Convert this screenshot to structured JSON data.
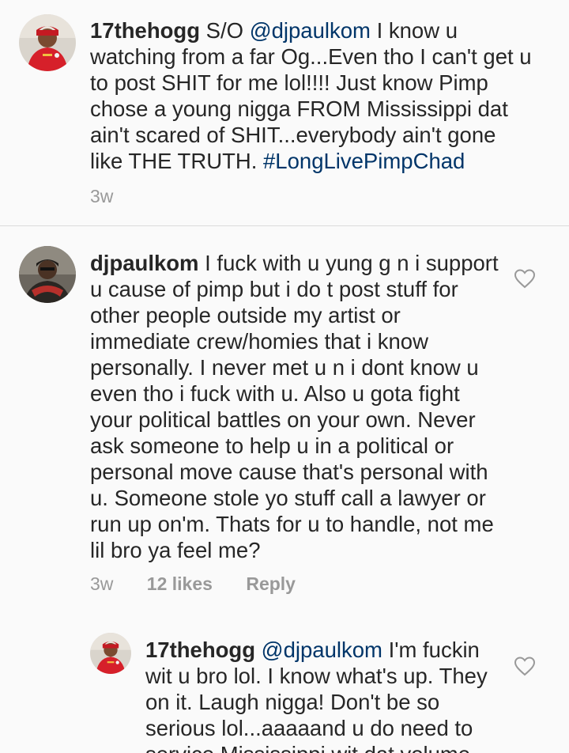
{
  "comments": [
    {
      "username": "17thehogg",
      "prefix": " S/O ",
      "mention": "@djpaulkom",
      "text": " I know u watching from a far Og...Even tho I can't get u to post SHIT for me lol!!!! Just know Pimp chose a young nigga FROM Mississippi dat ain't scared of SHIT...everybody ain't gone like THE TRUTH. ",
      "hashtag": "#LongLivePimpChad",
      "time": "3w"
    },
    {
      "username": "djpaulkom",
      "text": " I fuck with u yung g n i support u cause of pimp but i do t post stuff for other people outside my artist or immediate crew/homies that i know personally. I never met u n i dont know u even tho i fuck with u. Also u gota fight your political battles on your own. Never ask someone to help u in a political or personal move cause that's personal with u. Someone stole yo stuff call a lawyer or run up on'm. Thats for u to handle, not me lil bro ya feel me?",
      "time": "3w",
      "likes": "12 likes",
      "reply": "Reply",
      "icon": "heart-outline-icon"
    },
    {
      "username": "17thehogg",
      "mention": "@djpaulkom",
      "text": " I'm fuckin wit u bro lol. I know what's up. They on it. Laugh nigga! Don't be so serious lol...aaaaand u do need to service Mississippi wit dat volume",
      "icon": "heart-outline-icon"
    }
  ],
  "colors": {
    "background": "#fafafa",
    "text": "#262626",
    "link": "#003569",
    "meta": "#999999",
    "divider": "#dbdbdb"
  }
}
